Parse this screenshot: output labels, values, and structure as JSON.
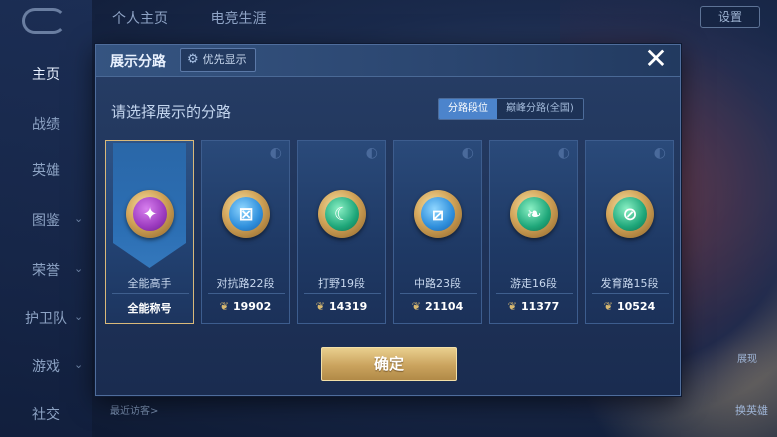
{
  "background": {
    "top_tabs": [
      "个人主页",
      "电竞生涯"
    ],
    "settings_label": "设置",
    "sidebar": [
      {
        "label": "主页",
        "active": true
      },
      {
        "label": "战绩",
        "active": false
      },
      {
        "label": "英雄",
        "active": false
      },
      {
        "label": "图鉴",
        "active": false
      },
      {
        "label": "荣誉",
        "active": false
      },
      {
        "label": "护卫队",
        "active": false
      },
      {
        "label": "游戏",
        "active": false
      },
      {
        "label": "社交",
        "active": false
      }
    ],
    "recent_visitors": "最近访客>",
    "right_buttons": [
      "展现",
      "换英雄"
    ]
  },
  "dialog": {
    "title": "展示分路",
    "priority_label": "优先显示",
    "close_symbol": "✕",
    "subtitle": "请选择展示的分路",
    "toggle": {
      "options": [
        "分路段位",
        "巅峰分路(全国)"
      ],
      "selected": "分路段位"
    },
    "cards": [
      {
        "name": "全能高手",
        "score": "全能称号",
        "badge_color": "purple",
        "icon": "allround-icon",
        "selected": true
      },
      {
        "name": "对抗路22段",
        "score": "19902",
        "badge_color": "blue",
        "icon": "clash-lane-icon",
        "selected": false
      },
      {
        "name": "打野19段",
        "score": "14319",
        "badge_color": "green",
        "icon": "jungle-icon",
        "selected": false
      },
      {
        "name": "中路23段",
        "score": "21104",
        "badge_color": "blue",
        "icon": "mid-lane-icon",
        "selected": false
      },
      {
        "name": "游走16段",
        "score": "11377",
        "badge_color": "green",
        "icon": "roam-icon",
        "selected": false
      },
      {
        "name": "发育路15段",
        "score": "10524",
        "badge_color": "green",
        "icon": "farm-lane-icon",
        "selected": false
      }
    ],
    "confirm_label": "确定"
  },
  "colors": {
    "accent_gold": "#d9b97a",
    "toggle_active": "#4c84cc",
    "dialog_bg": "#1e3258"
  }
}
